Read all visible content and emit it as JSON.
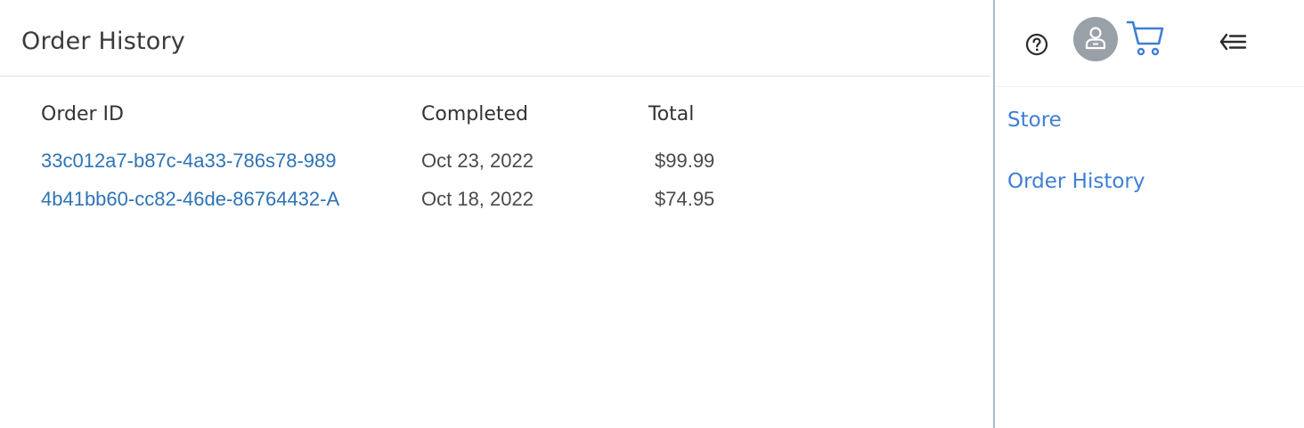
{
  "page": {
    "title": "Order History"
  },
  "table": {
    "headers": [
      "Order ID",
      "Completed",
      "Total"
    ],
    "rows": [
      {
        "order_id": "33c012a7-b87c-4a33-786s78-989",
        "completed": "Oct 23, 2022",
        "total": "$99.99"
      },
      {
        "order_id": "4b41bb60-cc82-46de-86764432-A",
        "completed": "Oct 18, 2022",
        "total": "$74.95"
      }
    ]
  },
  "panel": {
    "icons": [
      "help-icon",
      "user-avatar-icon",
      "cart-icon",
      "collapse-menu-icon"
    ],
    "nav": [
      {
        "label": "Store"
      },
      {
        "label": "Order History"
      }
    ]
  },
  "colors": {
    "link": "#2f73b4",
    "nav_link": "#3f7fd3",
    "avatar_bg": "#9aa0a8",
    "cart": "#3f7fd3",
    "panel_border": "#a9bdd0"
  }
}
